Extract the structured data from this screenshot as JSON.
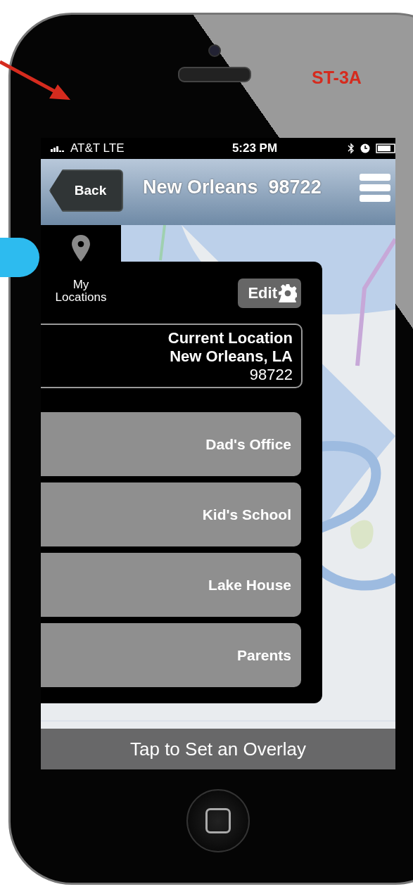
{
  "annotation": {
    "label": "ST-3A"
  },
  "status_bar": {
    "carrier": "AT&T LTE",
    "time": "5:23 PM"
  },
  "nav_bar": {
    "back": "Back",
    "title": "New Orleans  98722"
  },
  "locations_tab": {
    "label": "My Locations"
  },
  "panel": {
    "edit": "Edit",
    "current": {
      "title": "Current Location",
      "city": "New Orleans, LA",
      "zip": "98722"
    },
    "locations": [
      {
        "name": "Dad's Office"
      },
      {
        "name": "Kid's School"
      },
      {
        "name": "Lake House"
      },
      {
        "name": "Parents"
      }
    ]
  },
  "overlay_bar": {
    "label": "Tap to Set an Overlay"
  }
}
